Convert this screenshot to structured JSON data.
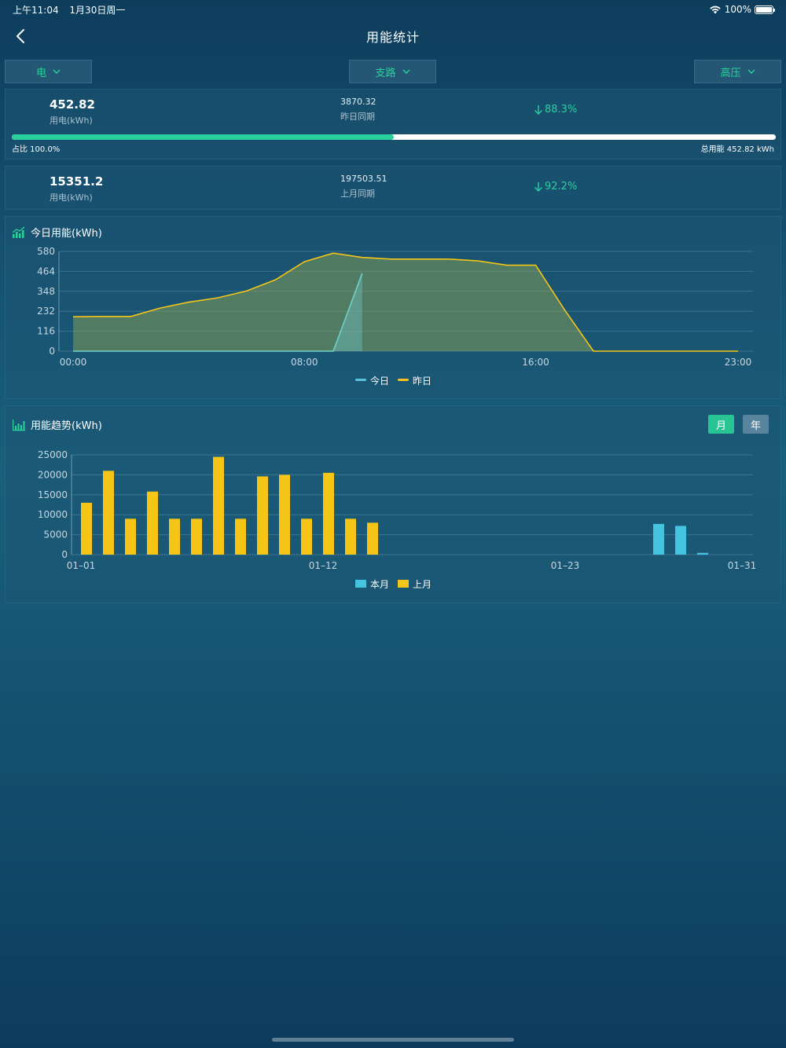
{
  "status_bar": {
    "time": "上午11:04",
    "date": "1月30日周一",
    "battery": "100%"
  },
  "nav": {
    "title": "用能统计"
  },
  "filters": {
    "energy": "电",
    "branch": "支路",
    "voltage": "高压"
  },
  "today_stat": {
    "value": "452.82",
    "label": "用电(kWh)",
    "prev_value": "3870.32",
    "prev_label": "昨日同期",
    "change": "88.3%",
    "share_label": "占比 100.0%",
    "share": 1.0,
    "progress_fraction": 0.5,
    "total_label": "总用能 452.82 kWh"
  },
  "month_stat": {
    "value": "15351.2",
    "label": "用电(kWh)",
    "prev_value": "197503.51",
    "prev_label": "上月同期",
    "change": "92.2%"
  },
  "daily_chart_title": "今日用能(kWh)",
  "trend_chart_title": "用能趋势(kWh)",
  "trend_toggle": {
    "month": "月",
    "year": "年"
  },
  "colors": {
    "accent": "#29d19c",
    "today": "#5cc2e0",
    "yesterday": "#f5c518",
    "this_month": "#45c4e0",
    "last_month": "#f5c518"
  },
  "chart_data": [
    {
      "type": "area",
      "title": "今日用能(kWh)",
      "x": [
        "00:00",
        "01:00",
        "02:00",
        "03:00",
        "04:00",
        "05:00",
        "06:00",
        "07:00",
        "08:00",
        "09:00",
        "10:00",
        "11:00",
        "12:00",
        "13:00",
        "14:00",
        "15:00",
        "16:00",
        "17:00",
        "18:00",
        "19:00",
        "20:00",
        "21:00",
        "22:00",
        "23:00"
      ],
      "tick_labels": [
        "00:00",
        "08:00",
        "16:00",
        "23:00"
      ],
      "yticks": [
        0,
        116,
        232,
        348,
        464,
        580
      ],
      "ylim": [
        0,
        580
      ],
      "series": [
        {
          "name": "今日",
          "values": [
            0,
            0,
            0,
            0,
            0,
            0,
            0,
            0,
            0,
            0,
            452.82
          ]
        },
        {
          "name": "昨日",
          "values": [
            200,
            202,
            202,
            250,
            285,
            310,
            350,
            415,
            520,
            570,
            545,
            535,
            535,
            535,
            525,
            500,
            500,
            240,
            0,
            0,
            0,
            0,
            0,
            0
          ]
        }
      ],
      "legend": [
        "今日",
        "昨日"
      ],
      "legend_position": "bottom",
      "grid": true
    },
    {
      "type": "bar",
      "title": "用能趋势(kWh)",
      "categories": [
        "01-01",
        "01-02",
        "01-03",
        "01-04",
        "01-05",
        "01-06",
        "01-07",
        "01-08",
        "01-09",
        "01-10",
        "01-11",
        "01-12",
        "01-13",
        "01-14",
        "01-15",
        "01-16",
        "01-17",
        "01-18",
        "01-19",
        "01-20",
        "01-21",
        "01-22",
        "01-23",
        "01-24",
        "01-25",
        "01-26",
        "01-27",
        "01-28",
        "01-29",
        "01-30",
        "01-31"
      ],
      "tick_labels": [
        "01-01",
        "01-12",
        "01-23",
        "01-31"
      ],
      "yticks": [
        0,
        5000,
        10000,
        15000,
        20000,
        25000
      ],
      "ylim": [
        0,
        25000
      ],
      "series": [
        {
          "name": "本月",
          "values": [
            null,
            null,
            null,
            null,
            null,
            null,
            null,
            null,
            null,
            null,
            null,
            null,
            null,
            null,
            null,
            null,
            null,
            null,
            null,
            null,
            null,
            null,
            null,
            null,
            null,
            null,
            7700,
            7200,
            450,
            null,
            null
          ]
        },
        {
          "name": "上月",
          "values": [
            13000,
            21000,
            9000,
            15800,
            9000,
            9000,
            24500,
            9000,
            19600,
            20000,
            9000,
            20500,
            9000,
            8000,
            null,
            null,
            null,
            null,
            null,
            null,
            null,
            null,
            null,
            null,
            null,
            null,
            null,
            null,
            null,
            null,
            null
          ]
        }
      ],
      "legend": [
        "本月",
        "上月"
      ],
      "legend_position": "bottom",
      "grid": true
    }
  ]
}
